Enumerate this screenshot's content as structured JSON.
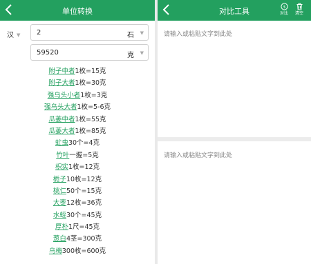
{
  "left": {
    "title": "单位转换",
    "language": "汉",
    "input_value": "2",
    "input_unit": "石",
    "result_value": "59520",
    "result_unit": "克",
    "items": [
      {
        "name": "附子中者",
        "rest": "1枚=15克"
      },
      {
        "name": "附子大者",
        "rest": "1枚=30克"
      },
      {
        "name": "强乌头小者",
        "rest": "1枚=3克"
      },
      {
        "name": "强乌头大者",
        "rest": "1枚=5-6克"
      },
      {
        "name": "瓜蒌中者",
        "rest": "1枚=55克"
      },
      {
        "name": "瓜蒌大者",
        "rest": "1枚=85克"
      },
      {
        "name": "虻虫",
        "rest": "30个=4克"
      },
      {
        "name": "竹叶",
        "rest": "一握=5克"
      },
      {
        "name": "枳实",
        "rest": "1枚=12克"
      },
      {
        "name": "栀子",
        "rest": "10枚=12克"
      },
      {
        "name": "桃仁",
        "rest": "50个=15克"
      },
      {
        "name": "大枣",
        "rest": "12枚=36克"
      },
      {
        "name": "水蛭",
        "rest": "30个=45克"
      },
      {
        "name": "厚朴",
        "rest": "1尺=45克"
      },
      {
        "name": "葱白",
        "rest": "4茎=300克"
      },
      {
        "name": "乌梅",
        "rest": "300枚=600克"
      }
    ]
  },
  "right": {
    "title": "对比工具",
    "compare_label": "对比",
    "clear_label": "清空",
    "placeholder1": "请输入或粘贴文字到此处",
    "placeholder2": "请输入或粘贴文字到此处"
  },
  "colors": {
    "appbar": "#23a05f",
    "link": "#23a05f"
  }
}
